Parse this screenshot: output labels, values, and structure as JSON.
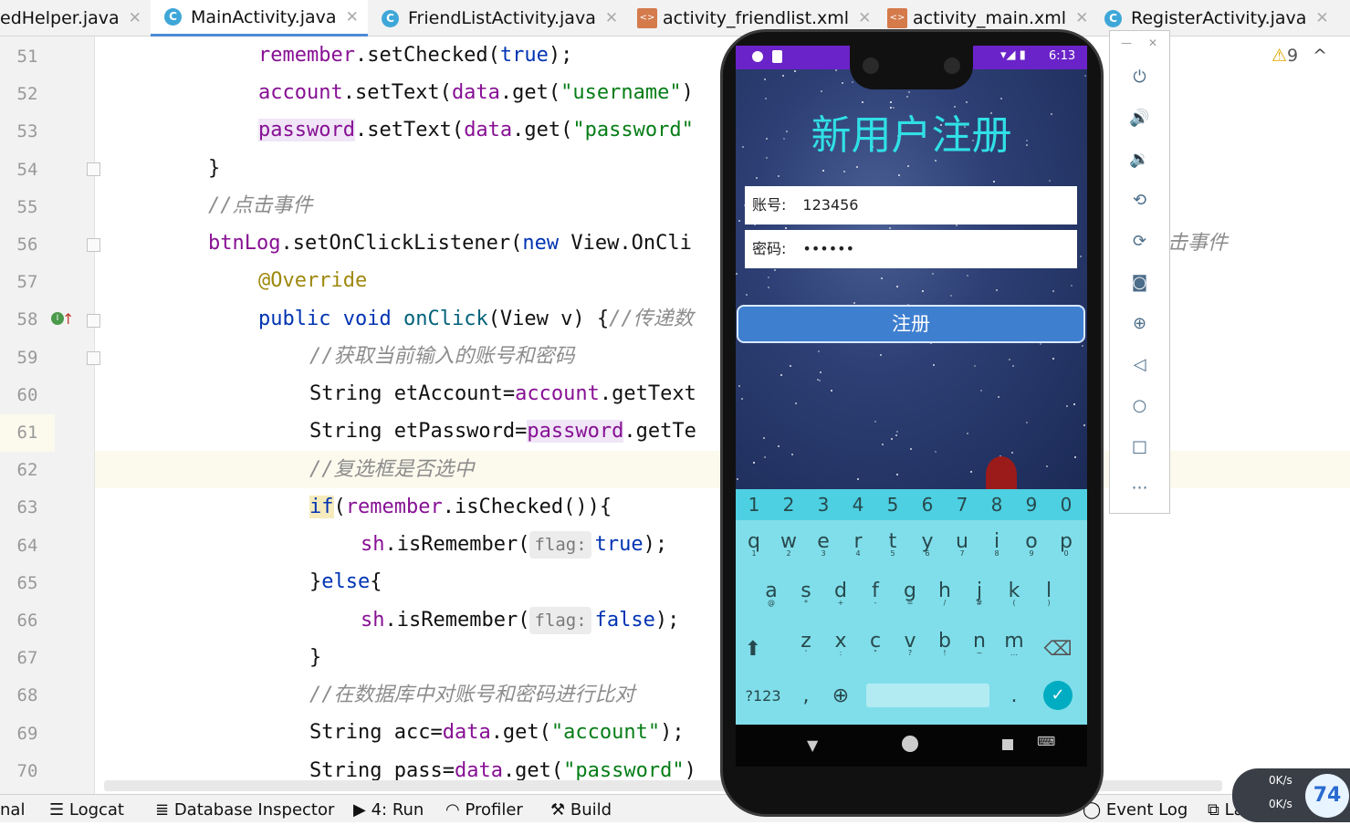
{
  "tabs": [
    {
      "label": "edHelper.java",
      "icon": "class-icon"
    },
    {
      "label": "MainActivity.java",
      "icon": "class-icon"
    },
    {
      "label": "FriendListActivity.java",
      "icon": "class-icon"
    },
    {
      "label": "activity_friendlist.xml",
      "icon": "xml-icon"
    },
    {
      "label": "activity_main.xml",
      "icon": "xml-icon"
    },
    {
      "label": "RegisterActivity.java",
      "icon": "class-icon"
    }
  ],
  "line_numbers": [
    "51",
    "52",
    "53",
    "54",
    "55",
    "56",
    "57",
    "58",
    "59",
    "60",
    "61",
    "62",
    "63",
    "64",
    "65",
    "66",
    "67",
    "68",
    "69",
    "70"
  ],
  "code": {
    "l51a": "remember",
    "l51b": ".setChecked(",
    "l51c": "true",
    "l51d": ");",
    "l52a": "account",
    "l52b": ".setText(",
    "l52c": "data",
    "l52d": ".get(",
    "l52e": "\"username\"",
    "l52f": ")",
    "l53a": "password",
    "l53b": ".setText(",
    "l53c": "data",
    "l53d": ".get(",
    "l53e": "\"password\"",
    "l54": "}",
    "l55": "//点击事件",
    "l56a": "btnLog",
    "l56b": ".setOnClickListener(",
    "l56c": "new",
    "l56d": " View.OnCli",
    "l56e": "击事件",
    "l57": "@Override",
    "l58a": "public",
    "l58b": "void",
    "l58c": "onClick",
    "l58d": "(View v) {",
    "l58e": "//传递数",
    "l59": "//获取当前输入的账号和密码",
    "l60a": "String etAccount=",
    "l60b": "account",
    "l60c": ".getText",
    "l61a": "String etPassword=",
    "l61b": "password",
    "l61c": ".getTe",
    "l62": "//复选框是否选中",
    "l63a": "if",
    "l63b": "(",
    "l63c": "remember",
    "l63d": ".isChecked()){",
    "l64a": "sh",
    "l64b": ".isRemember(",
    "l64hint": "flag:",
    "l64c": "true",
    "l64d": ");",
    "l65a": "}",
    "l65b": "else",
    "l65c": "{",
    "l66a": "sh",
    "l66b": ".isRemember(",
    "l66hint": "flag:",
    "l66c": "false",
    "l66d": ");",
    "l67": "}",
    "l68": "//在数据库中对账号和密码进行比对",
    "l69a": "String acc=",
    "l69b": "data",
    "l69c": ".get(",
    "l69d": "\"account\"",
    "l69e": ");",
    "l70a": "String pass=",
    "l70b": "data",
    "l70c": ".get(",
    "l70d": "\"password\"",
    "l70e": ")"
  },
  "warnings": {
    "count": "9"
  },
  "phone": {
    "time": "6:13",
    "title": "新用户注册",
    "account_label": "账号:",
    "account_value": "123456",
    "password_label": "密码:",
    "password_value": "••••••",
    "register_button": "注册",
    "kb_numbers": [
      "1",
      "2",
      "3",
      "4",
      "5",
      "6",
      "7",
      "8",
      "9",
      "0"
    ],
    "kb_row1": [
      "q",
      "w",
      "e",
      "r",
      "t",
      "y",
      "u",
      "i",
      "o",
      "p"
    ],
    "kb_row1_sub": [
      "1",
      "2",
      "3",
      "4",
      "5",
      "6",
      "7",
      "8",
      "9",
      "0"
    ],
    "kb_row2": [
      "a",
      "s",
      "d",
      "f",
      "g",
      "h",
      "j",
      "k",
      "l"
    ],
    "kb_row2_sub": [
      "@",
      "*",
      "+",
      "-",
      "=",
      "/",
      "#",
      "(",
      ")"
    ],
    "kb_row3": [
      "z",
      "x",
      "c",
      "v",
      "b",
      "n",
      "m"
    ],
    "kb_row3_sub": [
      "'",
      ":",
      "\"",
      "?",
      "!",
      "~",
      "…"
    ],
    "kb_symbols": "?123",
    "kb_comma": ",",
    "kb_period": "."
  },
  "status_bar": {
    "nal": "nal",
    "logcat": "Logcat",
    "db": "Database Inspector",
    "run": "4: Run",
    "profiler": "Profiler",
    "build": "Build",
    "eventlog": "Event Log",
    "layout": "Layout Ins"
  },
  "tray": {
    "up": "0K/s",
    "down": "0K/s",
    "pct": "74"
  },
  "colors": {
    "accent": "#4d8ad6",
    "keyword": "#0033b3",
    "field": "#871094",
    "string": "#067d17",
    "status_purple": "#6a23c8",
    "kb": "#80deea"
  }
}
